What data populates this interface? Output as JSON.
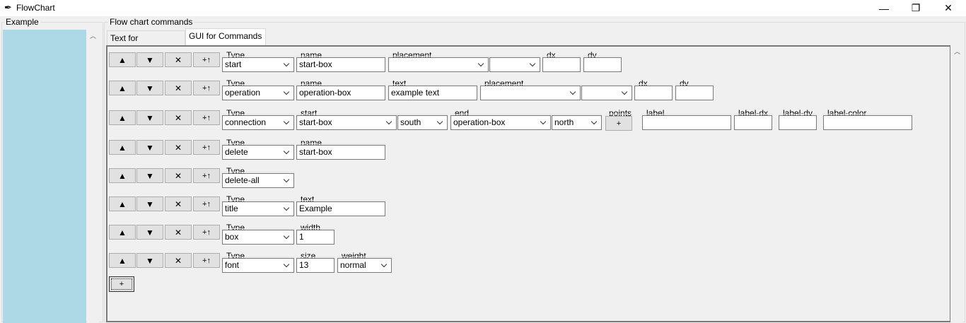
{
  "window": {
    "title": "FlowChart",
    "icon": "feather-icon"
  },
  "left_panel": {
    "label": "Example"
  },
  "right_panel": {
    "label": "Flow chart commands",
    "tabs": [
      {
        "label": "Text for Commands",
        "active": false
      },
      {
        "label": "GUI for Commands",
        "active": true
      }
    ]
  },
  "row_buttons": {
    "up": "▲",
    "down": "▼",
    "delete": "✕",
    "insert": "+↑"
  },
  "add_button": "+",
  "commands": [
    {
      "labels": {
        "type": "Type",
        "name": "name",
        "placement": "placement",
        "dx": "dx",
        "dy": "dy"
      },
      "values": {
        "type": "start",
        "name": "start-box",
        "placement": "",
        "placement2": "",
        "dx": "",
        "dy": ""
      }
    },
    {
      "labels": {
        "type": "Type",
        "name": "name",
        "text": "text",
        "placement": "placement",
        "dx": "dx",
        "dy": "dy"
      },
      "values": {
        "type": "operation",
        "name": "operation-box",
        "text": "example text",
        "placement": "",
        "placement2": "",
        "dx": "",
        "dy": ""
      }
    },
    {
      "labels": {
        "type": "Type",
        "start": "start",
        "end": "end",
        "points": "points",
        "label": "label",
        "label_dx": "label-dx",
        "label_dy": "label-dy",
        "label_color": "label-color"
      },
      "values": {
        "type": "connection",
        "start": "start-box",
        "start_dir": "south",
        "end": "operation-box",
        "end_dir": "north",
        "points_btn": "+",
        "label": "",
        "label_dx": "",
        "label_dy": "",
        "label_color": ""
      }
    },
    {
      "labels": {
        "type": "Type",
        "name": "name"
      },
      "values": {
        "type": "delete",
        "name": "start-box"
      }
    },
    {
      "labels": {
        "type": "Type"
      },
      "values": {
        "type": "delete-all"
      }
    },
    {
      "labels": {
        "type": "Type",
        "text": "text"
      },
      "values": {
        "type": "title",
        "text": "Example"
      }
    },
    {
      "labels": {
        "type": "Type",
        "width": "width"
      },
      "values": {
        "type": "box",
        "width": "1"
      }
    },
    {
      "labels": {
        "type": "Type",
        "size": "size",
        "weight": "weight"
      },
      "values": {
        "type": "font",
        "size": "13",
        "weight": "normal"
      }
    }
  ]
}
